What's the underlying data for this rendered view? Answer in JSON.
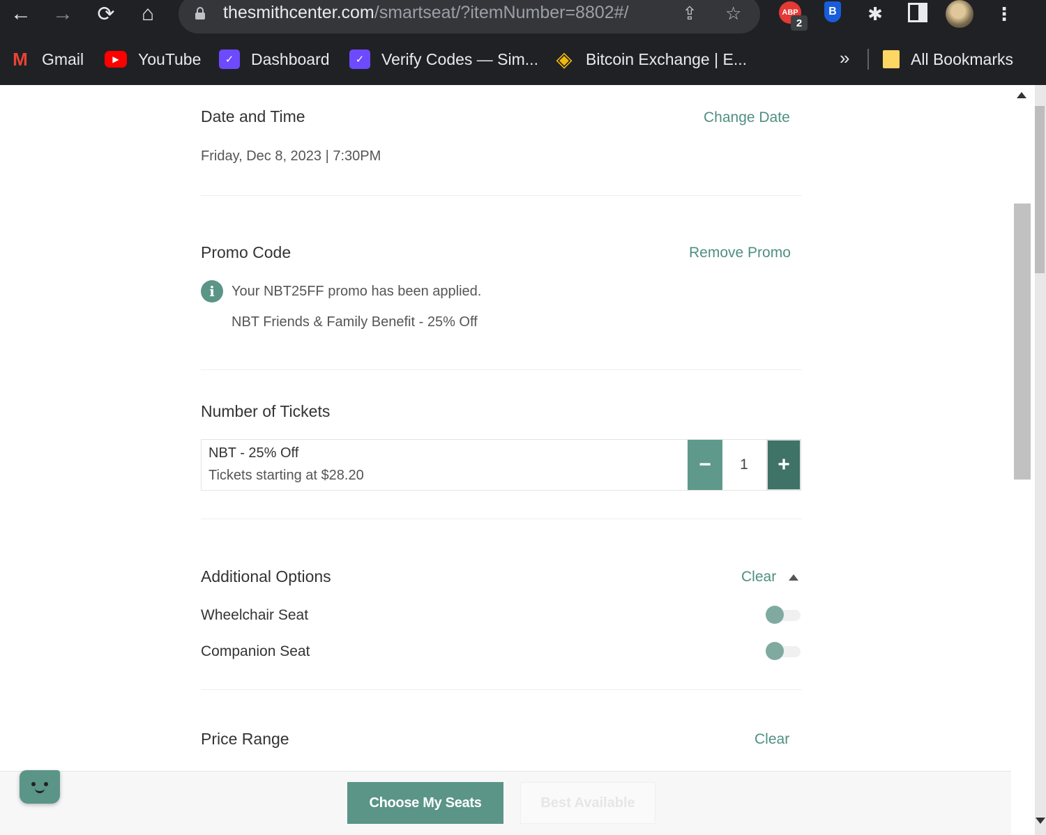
{
  "browser": {
    "url_host": "thesmithcenter.com",
    "url_path": "/smartseat/?itemNumber=8802#/",
    "nav": {
      "back": "←",
      "forward": "→",
      "reload": "⟳",
      "home": "⌂"
    },
    "icons": {
      "share": "⇪",
      "star": "☆",
      "puzzle": "✱",
      "kebab": "⋮"
    },
    "extensions": {
      "abp_label": "ABP",
      "abp_badge": "2",
      "bitwarden_label": "B"
    },
    "bookmarks": [
      {
        "label": "Gmail",
        "icon": "gmail-icon",
        "glyph": "M"
      },
      {
        "label": "YouTube",
        "icon": "youtube-icon",
        "glyph": "▶"
      },
      {
        "label": "Dashboard",
        "icon": "proton-icon",
        "glyph": "✓"
      },
      {
        "label": "Verify Codes — Sim...",
        "icon": "proton-icon",
        "glyph": "✓"
      },
      {
        "label": "Bitcoin Exchange | E...",
        "icon": "binance-icon",
        "glyph": "◈"
      }
    ],
    "bookmarks_more": "»",
    "all_bookmarks": "All Bookmarks"
  },
  "date_time": {
    "title": "Date and Time",
    "change_link": "Change Date",
    "value": "Friday, Dec 8, 2023 | 7:30PM"
  },
  "promo": {
    "title": "Promo Code",
    "remove_link": "Remove Promo",
    "info_glyph": "i",
    "message": "Your NBT25FF promo has been applied.",
    "detail": "NBT Friends & Family Benefit - 25% Off"
  },
  "tickets": {
    "title": "Number of Tickets",
    "type_name": "NBT - 25% Off",
    "price_text": "Tickets starting at $28.20",
    "minus": "−",
    "plus": "+",
    "quantity": "1"
  },
  "options": {
    "title": "Additional Options",
    "clear_link": "Clear",
    "items": [
      {
        "label": "Wheelchair Seat",
        "enabled": false
      },
      {
        "label": "Companion Seat",
        "enabled": false
      }
    ]
  },
  "price_range": {
    "title": "Price Range",
    "clear_link": "Clear"
  },
  "footer": {
    "primary_button": "Choose My Seats",
    "secondary_button": "Best Available"
  },
  "colors": {
    "accent": "#5a9587",
    "accent_dark": "#3f7368",
    "link": "#4f8f82",
    "chrome_bg": "#202124"
  }
}
